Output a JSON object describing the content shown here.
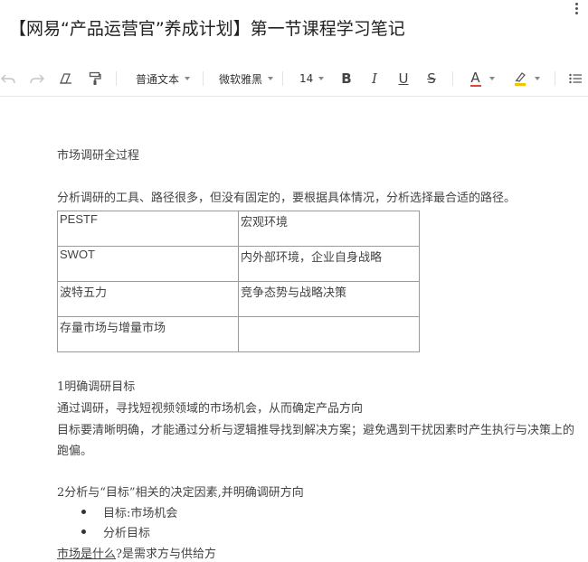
{
  "document": {
    "title": "【网易“产品运营官”养成计划】第一节课程学习笔记"
  },
  "toolbar": {
    "paragraph_style": "普通文本",
    "font_family": "微软雅黑",
    "font_size": "14",
    "bold_label": "B",
    "italic_label": "I",
    "underline_label": "U",
    "strike_label": "S",
    "text_color_label": "A",
    "text_color": "#e0453a",
    "highlight_color": "#f3c300"
  },
  "content": {
    "heading": "市场调研全过程",
    "intro": "分析调研的工具、路径很多，但没有固定的，要根据具体情况，分析选择最合适的路径。",
    "table": [
      [
        "PESTF",
        "宏观环境"
      ],
      [
        "SWOT",
        "内外部环境，企业自身战略"
      ],
      [
        "波特五力",
        "竞争态势与战略决策"
      ],
      [
        "存量市场与增量市场",
        ""
      ]
    ],
    "section1_title": "1明确调研目标",
    "section1_p1": "通过调研，寻找短视频领域的市场机会，从而确定产品方向",
    "section1_p2a": "目标要清晰明确，才能通过分析与逻辑推导找到解决方案；避免遇到干扰因素时产生执行与决策上的",
    "section1_p2b": "跑偏。",
    "section2_title": "2分析与“目标”相关的决定因素,并明确调研方向",
    "bullets": [
      "目标:市场机会",
      "分析目标"
    ],
    "last_underlined": "市场是什么",
    "last_rest": "?是需求方与供给方"
  }
}
